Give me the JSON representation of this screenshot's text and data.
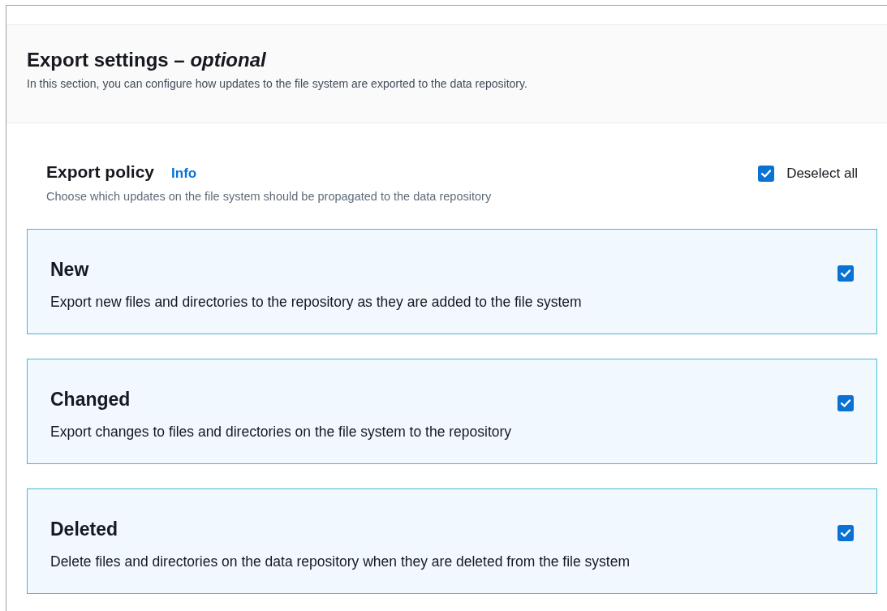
{
  "section": {
    "title": "Export settings – *optional*",
    "description": "In this section, you can configure how updates to the file system are exported to the data repository."
  },
  "policy": {
    "label": "Export policy",
    "info_link": "Info",
    "description": "Choose which updates on the file system should be propagated to the data repository",
    "toggle_all": {
      "label": "Deselect all",
      "checked": true
    }
  },
  "options": [
    {
      "title": "New",
      "description": "Export new files and directories to the repository as they are added to the file system",
      "checked": true
    },
    {
      "title": "Changed",
      "description": "Export changes to files and directories on the file system to the repository",
      "checked": true
    },
    {
      "title": "Deleted",
      "description": "Delete files and directories on the data repository when they are deleted from the file system",
      "checked": true
    }
  ]
}
